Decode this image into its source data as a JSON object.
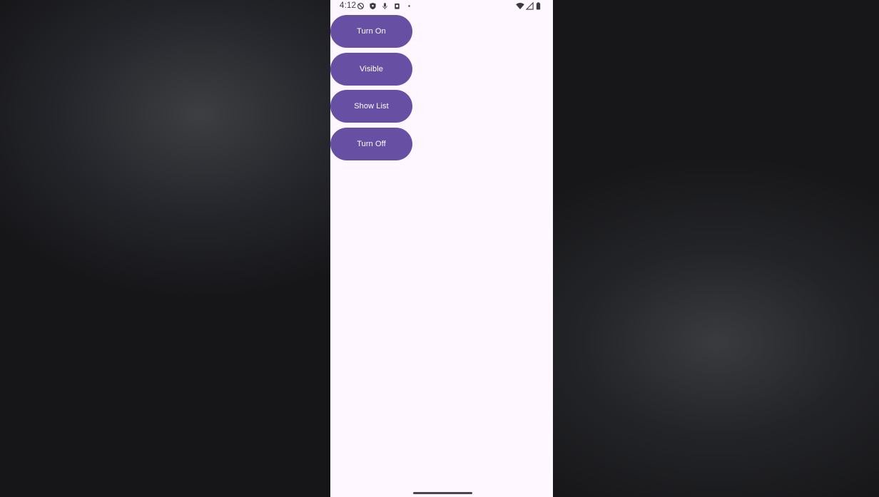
{
  "status_bar": {
    "time": "4:12",
    "left_icons": [
      "do-not-disturb-icon",
      "shield-icon",
      "mic-icon",
      "clipboard-icon",
      "dot-icon"
    ],
    "right_icons": [
      "wifi-icon",
      "signal-icon",
      "battery-icon"
    ]
  },
  "buttons": [
    {
      "label": "Turn On"
    },
    {
      "label": "Visible"
    },
    {
      "label": "Show List"
    },
    {
      "label": "Turn Off"
    }
  ],
  "colors": {
    "button_bg": "#6750a4",
    "screen_bg": "#fef7ff",
    "backdrop": "#17171a"
  }
}
